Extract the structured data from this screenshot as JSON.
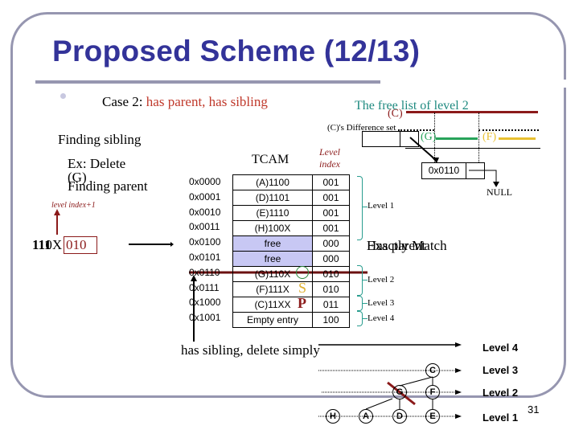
{
  "slide": {
    "title": "Proposed Scheme (12/13)",
    "page_number": "31",
    "bullet": {
      "prefix": "Case 2: ",
      "highlight": "has parent, has sibling"
    },
    "free_list_title": "The free list of level 2",
    "free_list_overlap_label": "(C)",
    "difference_set_label": "(C)'s Difference set",
    "g_label": "(G)",
    "f_label": "(F)",
    "pointer_value": "0x0110",
    "null_label": "NULL",
    "finding_sibling": "Finding sibling",
    "ex_delete": "Ex: Delete",
    "ex_delete_target": "(G)",
    "finding_parent": "Finding parent",
    "level_index_note": "level index+1",
    "key_prefix": "110X",
    "key_prefix_overlap": "111",
    "key_suffix": "010",
    "key_suffix_overlap": "011",
    "overlap_text_a": "Exactly Match",
    "overlap_text_b": "Has parent",
    "has_sibling_note": "has sibling, delete simply",
    "markers": {
      "circle": "",
      "s": "S",
      "p": "P"
    }
  },
  "tcam": {
    "title": "TCAM",
    "level_index_header_1": "Level",
    "level_index_header_2": "index",
    "rows": [
      {
        "addr": "0x0000",
        "entry": "(A)1100",
        "level": "001",
        "free": false
      },
      {
        "addr": "0x0001",
        "entry": "(D)1101",
        "level": "001",
        "free": false
      },
      {
        "addr": "0x0010",
        "entry": "(E)1110",
        "level": "001",
        "free": false
      },
      {
        "addr": "0x0011",
        "entry": "(H)100X",
        "level": "001",
        "free": false
      },
      {
        "addr": "0x0100",
        "entry": "free",
        "level": "000",
        "free": true
      },
      {
        "addr": "0x0101",
        "entry": "free",
        "level": "000",
        "free": true
      },
      {
        "addr": "0x0110",
        "entry": "(G)110X",
        "level": "010",
        "free": false
      },
      {
        "addr": "0x0111",
        "entry": "(F)111X",
        "level": "010",
        "free": false
      },
      {
        "addr": "0x1000",
        "entry": "(C)11XX",
        "level": "011",
        "free": false
      },
      {
        "addr": "0x1001",
        "entry": "Empty entry",
        "level": "100",
        "free": false
      }
    ],
    "levels": [
      "Level 1",
      "Level 2",
      "Level 3",
      "Level 4"
    ]
  },
  "tree": {
    "levels": [
      "Level 4",
      "Level 3",
      "Level 2",
      "Level 1"
    ],
    "nodes": {
      "level3": [
        "C"
      ],
      "level2": [
        "G",
        "F"
      ],
      "level1": [
        "H",
        "A",
        "D",
        "E"
      ]
    }
  },
  "colors": {
    "title": "#333399",
    "frame": "#9696b0",
    "accent_red": "#8b1a1a",
    "teal": "#2a9d8f",
    "green": "#27a35a",
    "yellow": "#e8c030"
  }
}
